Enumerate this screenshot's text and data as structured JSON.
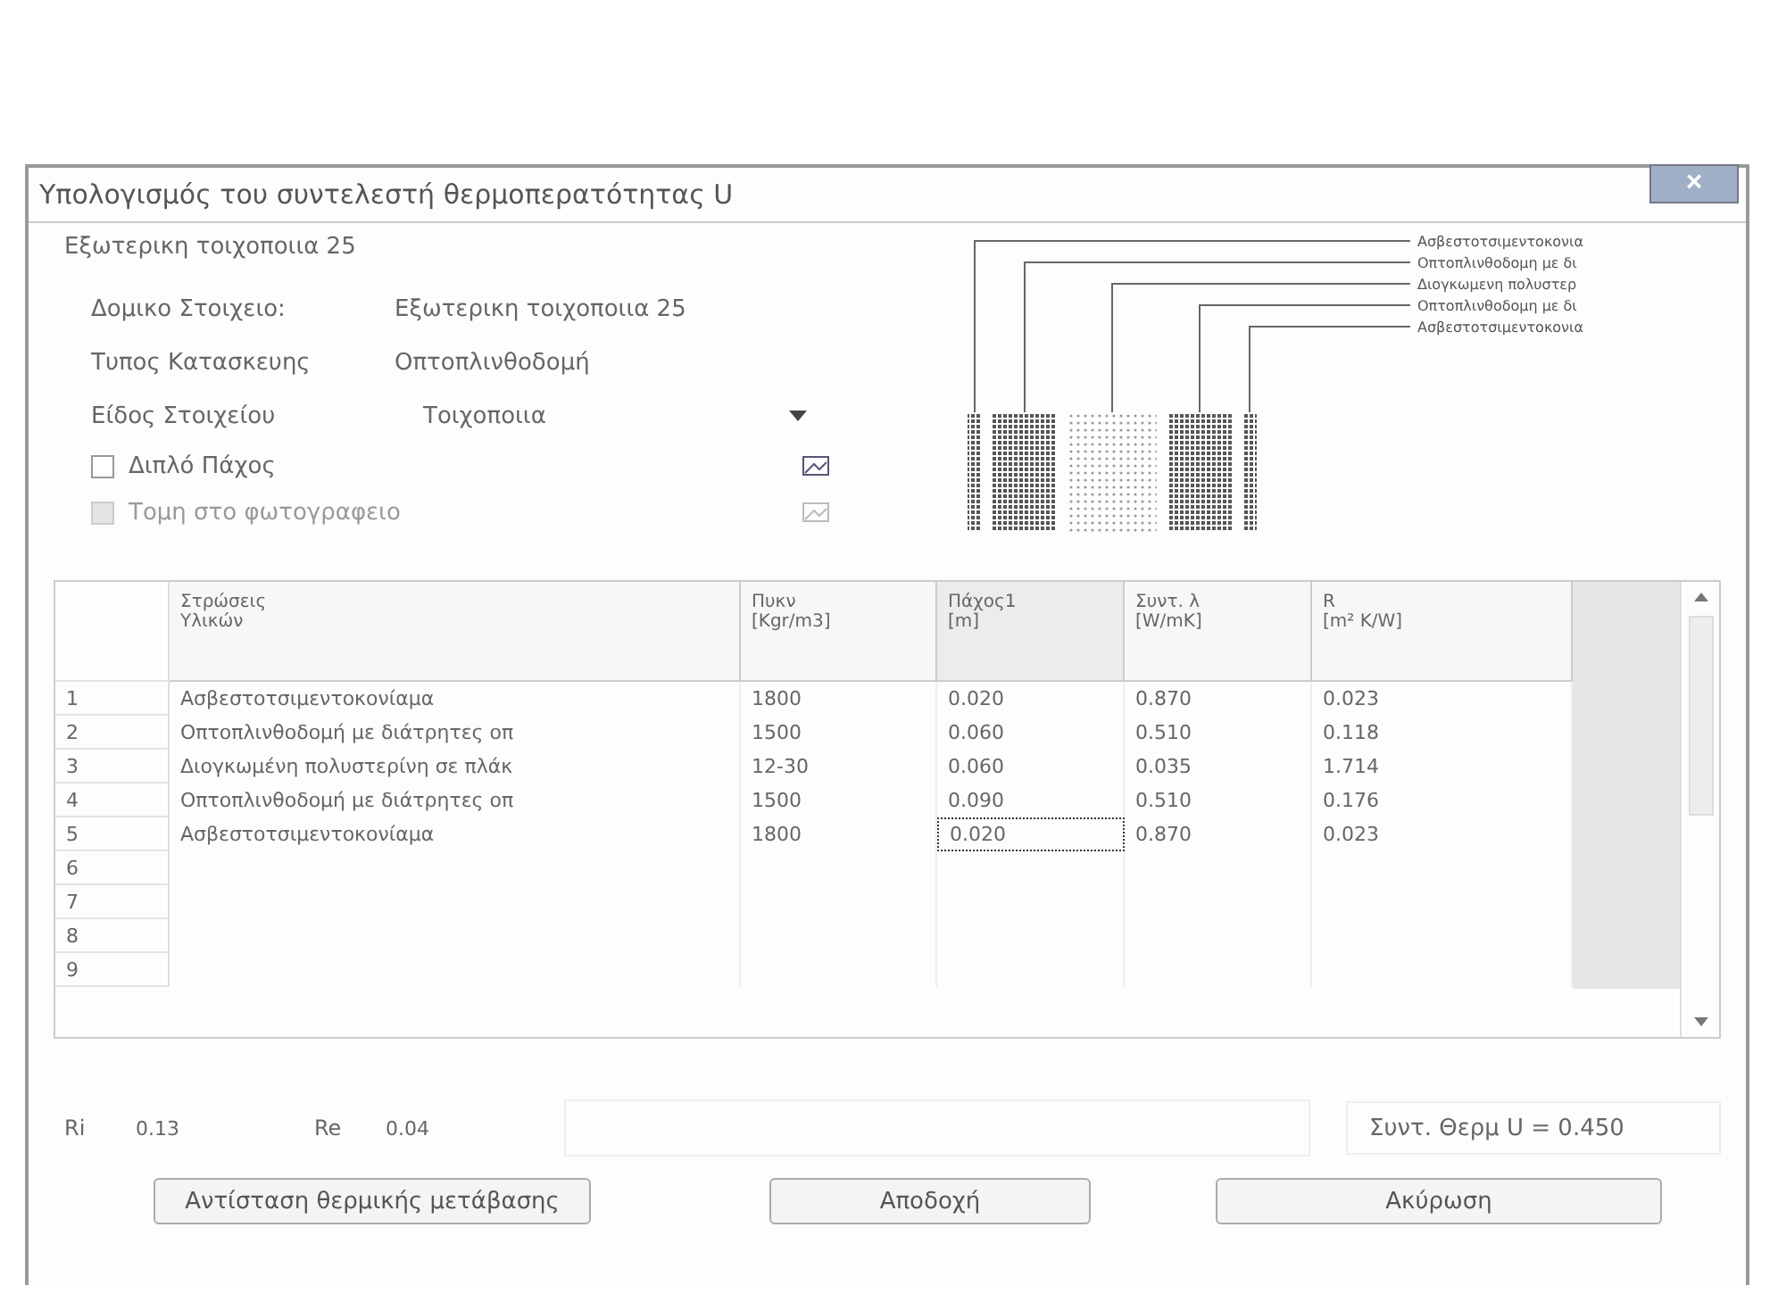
{
  "window": {
    "title": "Υπολογισμός του συντελεστή θερμοπερατότητας U",
    "close": "×"
  },
  "group": {
    "title": "Εξωτερικη τοιχοποιια 25"
  },
  "fields": [
    {
      "kind": "text",
      "label": "Δομικο Στοιχειο:",
      "value": "Εξωτερικη τοιχοποιια 25"
    },
    {
      "kind": "text",
      "label": "Τυπος Κατασκευης",
      "value": "Οπτοπλινθοδομή"
    },
    {
      "kind": "dropdown",
      "label": "Είδος Στοιχείου",
      "value": "Τοιχοποιια"
    }
  ],
  "checkboxes": [
    {
      "label": "Διπλό Πάχος",
      "checked": false,
      "disabled": false
    },
    {
      "label": "Τομη στο φωτογραφειο",
      "checked": false,
      "disabled": true
    }
  ],
  "diagram": {
    "layers": [
      {
        "label": "Ασβεστοτσιμεντοκονια",
        "kind": "plaster"
      },
      {
        "label": "Οπτοπλινθοδομη με δι",
        "kind": "brick"
      },
      {
        "label": "Διογκωμενη πολυστερ",
        "kind": "insulation"
      },
      {
        "label": "Οπτοπλινθοδομη με δι",
        "kind": "brick"
      },
      {
        "label": "Ασβεστοτσιμεντοκονια",
        "kind": "plaster"
      }
    ]
  },
  "table": {
    "columns": [
      {
        "line1": "Στρώσεις",
        "line2": "Υλικών"
      },
      {
        "line1": "Πυκν",
        "line2": "[Kgr/m3]"
      },
      {
        "line1": "Πάχος1",
        "line2": "[m]"
      },
      {
        "line1": "Συντ. λ",
        "line2": "[W/mK]"
      },
      {
        "line1": "R",
        "line2": "[m² K/W]"
      }
    ],
    "rows": [
      {
        "number": "1",
        "cells": [
          {
            "text": "Ασβεστοτσιμεντοκονίαμα",
            "focused": false
          },
          {
            "text": "1800",
            "focused": false
          },
          {
            "text": "0.020",
            "focused": false
          },
          {
            "text": "0.870",
            "focused": false
          },
          {
            "text": "0.023",
            "focused": false
          }
        ]
      },
      {
        "number": "2",
        "cells": [
          {
            "text": "Οπτοπλινθοδομή με διάτρητες οπ",
            "focused": false
          },
          {
            "text": "1500",
            "focused": false
          },
          {
            "text": "0.060",
            "focused": false
          },
          {
            "text": "0.510",
            "focused": false
          },
          {
            "text": "0.118",
            "focused": false
          }
        ]
      },
      {
        "number": "3",
        "cells": [
          {
            "text": "Διογκωμένη πολυστερίνη σε πλάκ",
            "focused": false
          },
          {
            "text": "12-30",
            "focused": false
          },
          {
            "text": "0.060",
            "focused": false
          },
          {
            "text": "0.035",
            "focused": false
          },
          {
            "text": "1.714",
            "focused": false
          }
        ]
      },
      {
        "number": "4",
        "cells": [
          {
            "text": "Οπτοπλινθοδομή με διάτρητες οπ",
            "focused": false
          },
          {
            "text": "1500",
            "focused": false
          },
          {
            "text": "0.090",
            "focused": false
          },
          {
            "text": "0.510",
            "focused": false
          },
          {
            "text": "0.176",
            "focused": false
          }
        ]
      },
      {
        "number": "5",
        "cells": [
          {
            "text": "Ασβεστοτσιμεντοκονίαμα",
            "focused": false
          },
          {
            "text": "1800",
            "focused": false
          },
          {
            "text": "0.020",
            "focused": true
          },
          {
            "text": "0.870",
            "focused": false
          },
          {
            "text": "0.023",
            "focused": false
          }
        ]
      },
      {
        "number": "6",
        "cells": []
      },
      {
        "number": "7",
        "cells": []
      },
      {
        "number": "8",
        "cells": []
      },
      {
        "number": "9",
        "cells": []
      }
    ]
  },
  "resistances": {
    "ri_label": "Ri",
    "ri_value": "0.13",
    "re_label": "Re",
    "re_value": "0.04"
  },
  "result": "Συντ. Θερμ U = 0.450",
  "buttons": [
    "Αντίσταση θερμικής μετάβασης",
    "Αποδοχή",
    "Ακύρωση"
  ]
}
